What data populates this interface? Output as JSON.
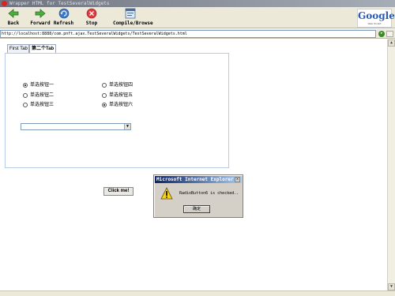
{
  "window": {
    "title": "Wrapper HTML for TestSeveralWidgets"
  },
  "toolbar": {
    "back_label": "Back",
    "forward_label": "Forward",
    "refresh_label": "Refresh",
    "stop_label": "Stop",
    "compile_label": "Compile/Browse"
  },
  "google": {
    "logo": "Google",
    "tagline": "Web Toolkit"
  },
  "address": {
    "url": "http://localhost:8888/com.pnft.ajax.TestSeveralWidgets/TestSeveralWidgets.html"
  },
  "tabs": [
    {
      "label": "First Tab",
      "selected": false
    },
    {
      "label": "第二个Tab",
      "selected": true
    }
  ],
  "radios": [
    {
      "label": "单选按钮一",
      "checked": true
    },
    {
      "label": "单选按钮二",
      "checked": false
    },
    {
      "label": "单选按钮三",
      "checked": false
    },
    {
      "label": "单选按钮四",
      "checked": false
    },
    {
      "label": "单选按钮五",
      "checked": false
    },
    {
      "label": "单选按钮六",
      "checked": true
    }
  ],
  "select": {
    "value": ""
  },
  "button": {
    "label": "Click me!"
  },
  "dialog": {
    "title": "Microsoft Internet Explorer",
    "message": "RadioButton6 is checked..",
    "ok_label": "确定"
  },
  "colors": {
    "title_bar": "#0a246a",
    "toolbar_bg": "#ece9d8",
    "dialog_bg": "#d4d0c8"
  },
  "icons": [
    "app-icon",
    "back-arrow-icon",
    "forward-arrow-icon",
    "refresh-icon",
    "stop-icon",
    "compile-browse-icon",
    "go-icon",
    "warning-icon",
    "close-icon",
    "chevron-down-icon"
  ]
}
